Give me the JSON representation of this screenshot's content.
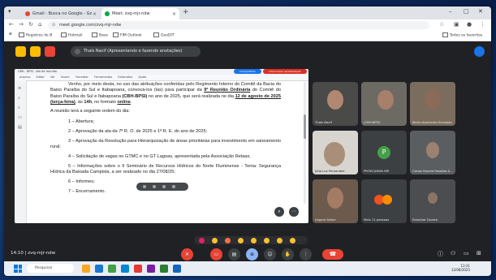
{
  "browser": {
    "tabs": [
      {
        "label": "Gmail - Busca no Google - Gz",
        "active": false
      },
      {
        "label": "Meet: zvq-mjr-ndw",
        "active": true
      }
    ],
    "new_tab": "+",
    "url": "meet.google.com/zvq-mjr-ndw",
    "bookmarks": [
      "Registros de B",
      "Hotmail",
      "Base",
      "FIM Outlook",
      "GeoDIT"
    ],
    "bookmarks_right": "Todos os favoritos"
  },
  "meet": {
    "presenting_text": "Thaís Nacif (Apresentando e fazendo anotações)",
    "meeting_code": "14:10  |  zvq-mjr-ndw",
    "participants": [
      {
        "name": "Thaís Nacif"
      },
      {
        "name": ""
      },
      {
        "name": "Mario Aparecido Serapion"
      },
      {
        "name": ""
      },
      {
        "name": "(CBH-BPSI)"
      },
      {
        "name": ""
      },
      {
        "name": "Júlia Luz Fernandes"
      },
      {
        "name": "PROEC/INMA MR",
        "initial": "P"
      },
      {
        "name": "Carlos Ronald Rosalba A..."
      },
      {
        "name": "Angelo Ariton"
      },
      {
        "name": "Mais 11 pessoas"
      },
      {
        "name": "Eleonhar Duarte"
      }
    ],
    "more_count": "Mais 11 pessoas"
  },
  "document": {
    "title": "CBH - BPSI - Ata de reunião",
    "ribbon": [
      "Arquivo",
      "Editar",
      "Ver",
      "Inserir",
      "Formatar",
      "Ferramentas",
      "Extensões",
      "Ajuda"
    ],
    "btn_share": "Compartilhar",
    "btn_stop": "Interromper apresentação",
    "intro_1": "Venho, por meio desta, no uso das atribuições conferidas pelo Regimento Interno do Comitê da Bacia do Baixo Paraíba do Sul e Itabapoana, convocá-los (las) para participar da",
    "intro_bold": "9ª Reunião Ordinária",
    "intro_2": "do Comitê do Baixo Paraíba do Sul e Itabapoana",
    "intro_org": "(CBH-BPSI)",
    "intro_3": "no ano de 2025, que será realizada no dia",
    "intro_date": "12 de agosto de 2025 (terça-feira)",
    "intro_4": ", às",
    "intro_time": "14h",
    "intro_5": ", no formato",
    "intro_format": "online",
    "intro_6": ".",
    "agenda_intro": "A reunião terá a seguinte ordem do dia:",
    "items": [
      "1 – Abertura;",
      "2 – Aprovação da ata da 7ª R. O. de 2025 e 1ª R. E. do ano de 2025;",
      "3 – Aprovação da Resolução para Hierarquização de áreas prioritárias para investimento em saneamento rural;",
      "4 – Solicitação de vagas no GTMC e no GT Lagoas, apresentada pela Associação Relaas;",
      "5 – Informações sobre o II Seminário de Recursos Hídricos do Norte Fluminense - Tema: Segurança Hídrica da Baixada Campista, a ser realizado no dia 27/08/25;",
      "6 – Informes;",
      "7 – Encerramento."
    ]
  },
  "taskbar": {
    "search_placeholder": "Pesquisar",
    "time": "13:31",
    "date": "12/08/2025"
  },
  "colors": {
    "meet_bg": "#202124",
    "accent_blue": "#1a73e8",
    "hangup_red": "#ea4335"
  }
}
